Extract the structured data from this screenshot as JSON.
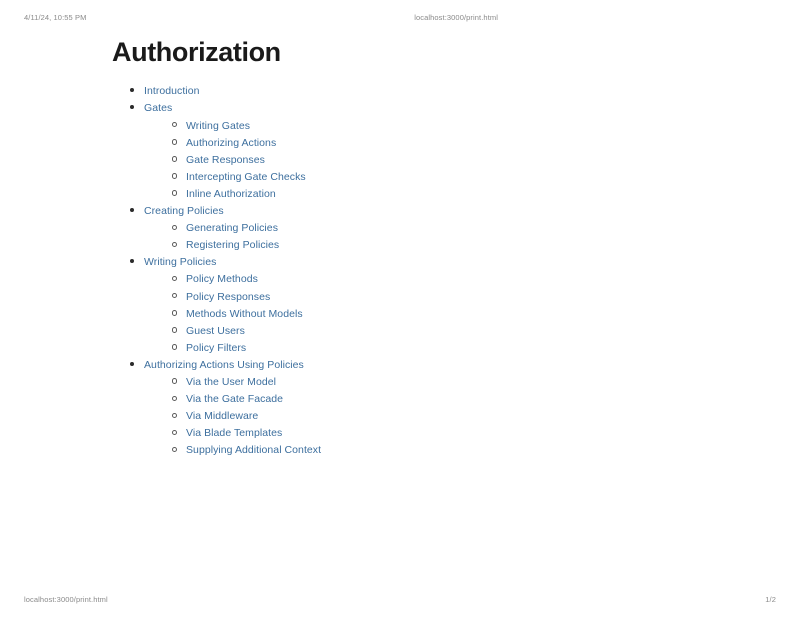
{
  "print_preview": {
    "header": {
      "datetime": "4/11/24, 10:55 PM",
      "url": "localhost:3000/print.html"
    },
    "footer": {
      "url": "localhost:3000/print.html",
      "page_indicator": "1/2"
    }
  },
  "document": {
    "title": "Authorization",
    "toc": [
      {
        "label": "Introduction",
        "children": []
      },
      {
        "label": "Gates",
        "children": [
          {
            "label": "Writing Gates"
          },
          {
            "label": "Authorizing Actions"
          },
          {
            "label": "Gate Responses"
          },
          {
            "label": "Intercepting Gate Checks"
          },
          {
            "label": "Inline Authorization"
          }
        ]
      },
      {
        "label": "Creating Policies",
        "children": [
          {
            "label": "Generating Policies"
          },
          {
            "label": "Registering Policies"
          }
        ]
      },
      {
        "label": "Writing Policies",
        "children": [
          {
            "label": "Policy Methods"
          },
          {
            "label": "Policy Responses"
          },
          {
            "label": "Methods Without Models"
          },
          {
            "label": "Guest Users"
          },
          {
            "label": "Policy Filters"
          }
        ]
      },
      {
        "label": "Authorizing Actions Using Policies",
        "children": [
          {
            "label": "Via the User Model"
          },
          {
            "label": "Via the Gate Facade"
          },
          {
            "label": "Via Middleware"
          },
          {
            "label": "Via Blade Templates"
          },
          {
            "label": "Supplying Additional Context"
          }
        ]
      }
    ]
  },
  "colors": {
    "link": "#3d6f9e",
    "title": "#1a1a1a",
    "chrome_text": "#8a8a8a",
    "page_background": "#ffffff"
  }
}
